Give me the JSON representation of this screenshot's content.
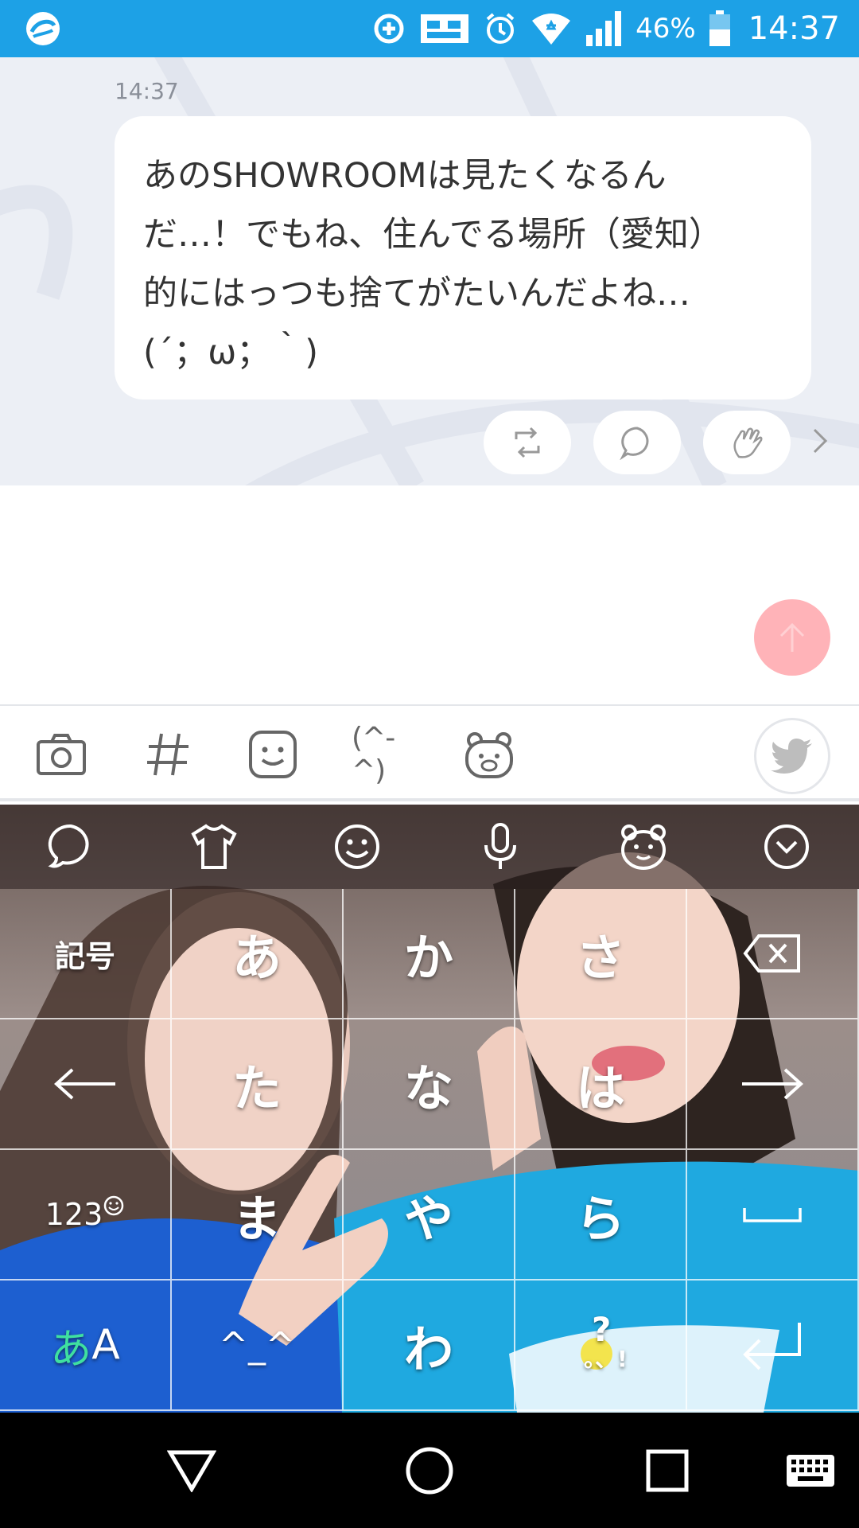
{
  "status_bar": {
    "battery_percent": "46%",
    "time": "14:37",
    "icons": [
      "app-logo-icon",
      "data-saver-icon",
      "sim-card-icon",
      "alarm-icon",
      "wifi-icon",
      "signal-icon",
      "battery-icon"
    ]
  },
  "message": {
    "time": "14:37",
    "text": "あのSHOWROOMは見たくなるん\nだ…！でもね、住んでる場所（愛知）\n的にはっつも捨てがたいんだよね…\n(´；ω；｀)"
  },
  "message_actions": [
    "retweet-icon",
    "reply-icon",
    "clap-icon",
    "chevron-right-icon"
  ],
  "toolbar": {
    "face_text": "(^-^)",
    "items": [
      "camera-icon",
      "hashtag-icon",
      "emoji-icon",
      "kaomoji-icon",
      "sticker-bear-icon",
      "twitter-icon"
    ]
  },
  "keyboard": {
    "top_icons": [
      "chat-icon",
      "theme-shirt-icon",
      "emoji-icon",
      "microphone-icon",
      "bear-icon",
      "collapse-icon"
    ],
    "keys": {
      "symbols": "記号",
      "a": "あ",
      "ka": "か",
      "sa": "さ",
      "left": "←",
      "ta": "た",
      "na": "な",
      "ha": "は",
      "right": "→",
      "num": "123",
      "ma": "ま",
      "ya": "や",
      "ra": "ら",
      "mode_kana": "あ",
      "mode_latin": "A",
      "face": "^_^",
      "wa": "わ"
    }
  },
  "colors": {
    "status_bar": "#1da1e6",
    "chat_background": "#eceff5",
    "scroll_top_button": "#ffb3b8",
    "navbar": "#000000"
  }
}
